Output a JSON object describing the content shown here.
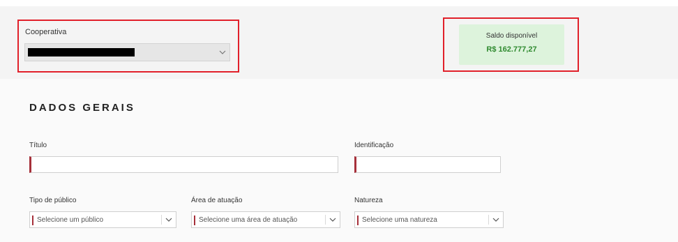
{
  "top": {
    "cooperativa": {
      "label": "Cooperativa",
      "value_redacted": true,
      "chevron_icon": "chevron-down-icon"
    },
    "saldo": {
      "label": "Saldo disponível",
      "value": "R$ 162.777,27",
      "value_color": "#2f8a2f",
      "card_color": "#ddf3dc"
    },
    "highlight_color": "#e1202a"
  },
  "section": {
    "title": "DADOS GERAIS"
  },
  "form": {
    "titulo": {
      "label": "Título",
      "value": ""
    },
    "identificacao": {
      "label": "Identificação",
      "value": ""
    },
    "tipo_publico": {
      "label": "Tipo de público",
      "placeholder": "Selecione um público"
    },
    "area_atuacao": {
      "label": "Área de atuação",
      "placeholder": "Selecione uma área de atuação"
    },
    "natureza": {
      "label": "Natureza",
      "placeholder": "Selecione uma natureza"
    },
    "required_marker_color": "#a6303a"
  }
}
